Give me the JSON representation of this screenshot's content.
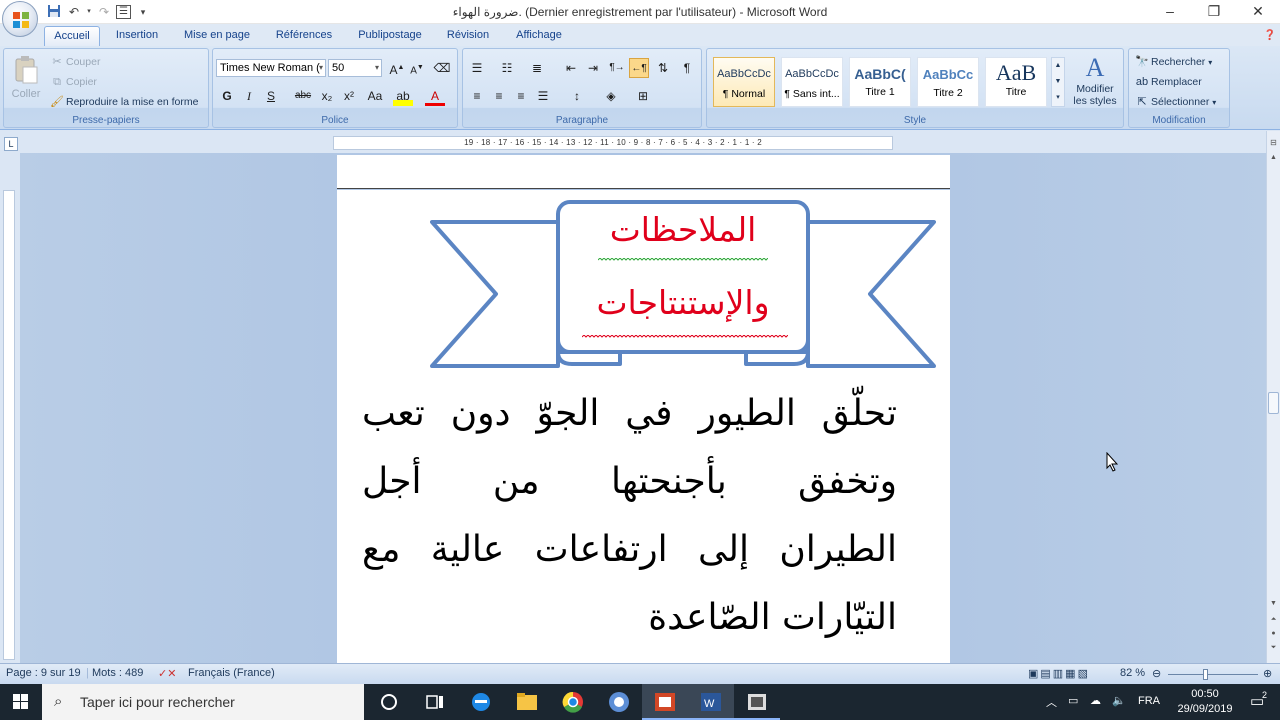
{
  "window": {
    "title": "ضرورة الهواء. (Dernier enregistrement par l'utilisateur) - Microsoft Word",
    "minimize": "–",
    "maximize": "❐",
    "close": "✕"
  },
  "tabs": [
    "Accueil",
    "Insertion",
    "Mise en page",
    "Références",
    "Publipostage",
    "Révision",
    "Affichage"
  ],
  "clipboard": {
    "paste": "Coller",
    "cut": "Couper",
    "copy": "Copier",
    "format_painter": "Reproduire la mise en forme",
    "label": "Presse-papiers"
  },
  "font": {
    "family": "Times New Roman (",
    "size": "50",
    "label": "Police",
    "bold": "G",
    "italic": "I",
    "underline": "S",
    "strike": "abc",
    "subscript": "x₂",
    "superscript": "x²",
    "case": "Aa"
  },
  "paragraph": {
    "label": "Paragraphe"
  },
  "styles": {
    "label": "Style",
    "items": [
      {
        "preview": "AaBbCcDc",
        "name": "¶ Normal"
      },
      {
        "preview": "AaBbCcDc",
        "name": "¶ Sans int..."
      },
      {
        "preview": "AaBbC(",
        "name": "Titre 1"
      },
      {
        "preview": "AaBbCc",
        "name": "Titre 2"
      },
      {
        "preview": "AaB",
        "name": "Titre"
      }
    ],
    "modify_line1": "Modifier",
    "modify_line2": "les styles"
  },
  "editing": {
    "label": "Modification",
    "find": "Rechercher",
    "replace": "Remplacer",
    "select": "Sélectionner"
  },
  "ruler": {
    "text": "19 · 18 · 17 · 16 · 15 · 14 · 13 · 12 · 11 · 10 · 9 · 8 · 7 · 6 · 5 · 4 · 3 · 2 · 1 · 1 · 2"
  },
  "document": {
    "banner_line1": "الملاحظات",
    "banner_line2": "والإستنتاجات",
    "body_lines": [
      "تحلّق الطيور في الجوّ دون تعب",
      "وتخفق بأجنحتها من أجل",
      "الطيران إلى ارتفاعات عالية مع",
      "التيّارات الصّاعدة"
    ],
    "banner_color": "#5b85c3",
    "text_color": "#e0001b"
  },
  "status": {
    "page": "Page : 9 sur 19",
    "words": "Mots : 489",
    "language": "Français (France)",
    "zoom": "82 %"
  },
  "taskbar": {
    "search_placeholder": "Taper ici pour rechercher",
    "lang": "FRA",
    "time": "00:50",
    "date": "29/09/2019",
    "notif_count": "2"
  }
}
